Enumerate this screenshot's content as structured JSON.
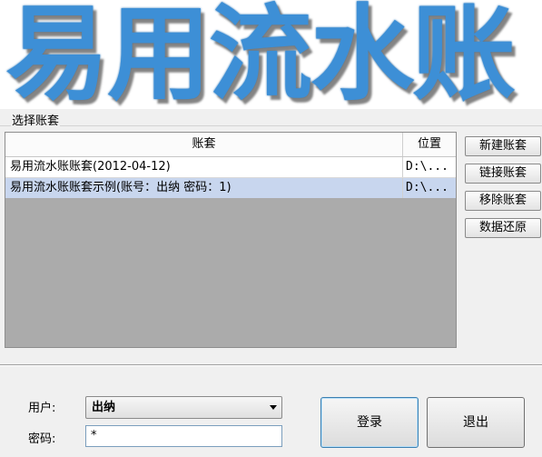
{
  "banner": {
    "title": "易用流水账"
  },
  "account_group": {
    "label": "选择账套",
    "columns": [
      "账套",
      "位置"
    ],
    "rows": [
      {
        "name": "易用流水账账套(2012-04-12)",
        "location": "D:\\...",
        "selected": false
      },
      {
        "name": "易用流水账账套示例(账号：出纳 密码：1)",
        "location": "D:\\...",
        "selected": true
      }
    ]
  },
  "side_buttons": {
    "new": "新建账套",
    "link": "链接账套",
    "remove": "移除账套",
    "restore": "数据还原"
  },
  "login": {
    "user_label": "用户:",
    "user_value": "出纳",
    "password_label": "密码:",
    "password_value": "*",
    "login_button": "登录",
    "exit_button": "退出"
  },
  "colors": {
    "banner_blue": "#3d8fd6",
    "selected_row": "#c8d6ee",
    "table_empty": "#ababab"
  }
}
